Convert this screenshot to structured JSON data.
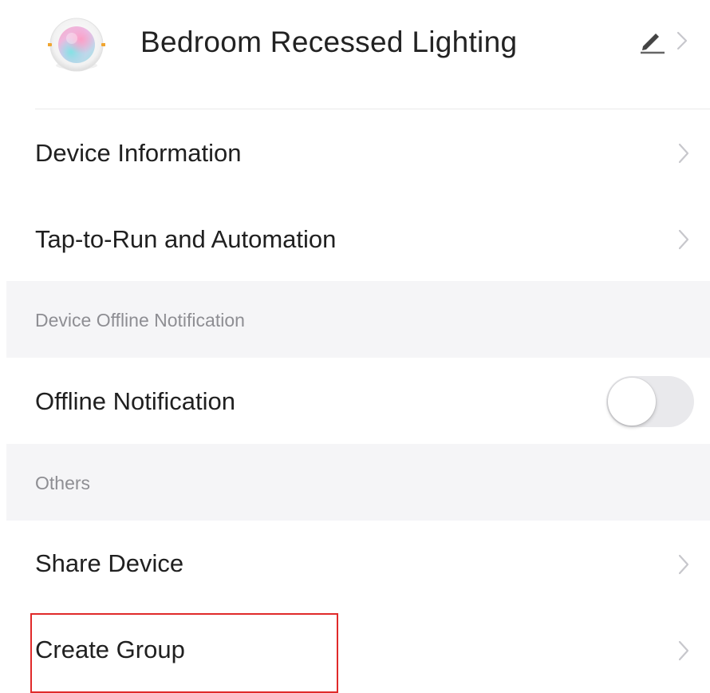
{
  "header": {
    "device_name": "Bedroom Recessed Lighting",
    "icon": "recessed-light-icon",
    "edit_icon": "pencil-icon"
  },
  "rows": {
    "device_information": "Device Information",
    "tap_to_run": "Tap-to-Run and Automation",
    "offline_notification": "Offline Notification",
    "share_device": "Share Device",
    "create_group": "Create Group"
  },
  "sections": {
    "device_offline_notification": "Device Offline Notification",
    "others": "Others"
  },
  "toggles": {
    "offline_notification_on": false
  },
  "colors": {
    "section_background": "#f5f5f7",
    "section_text": "#8e8e93",
    "chevron": "#c7c7cc",
    "highlight": "#e02a2a",
    "toggle_off_track": "#e9e9ec"
  }
}
